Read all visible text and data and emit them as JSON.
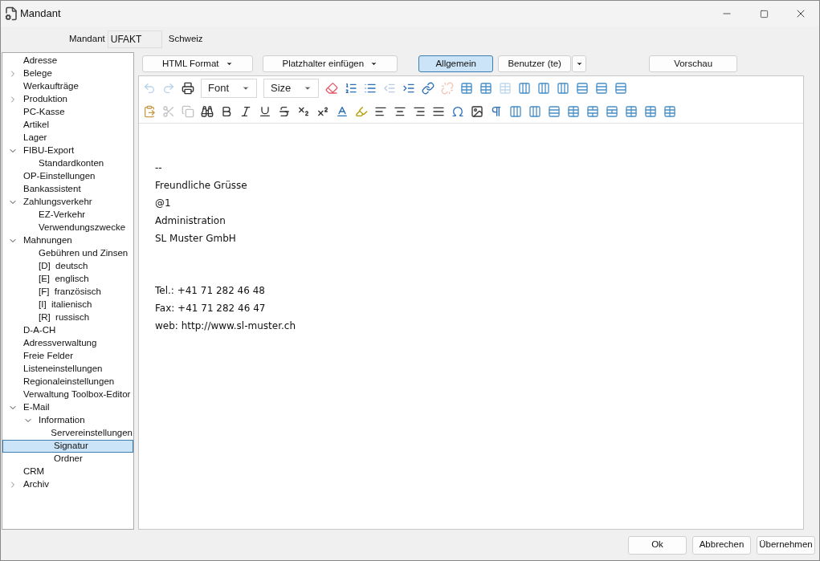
{
  "window": {
    "title": "Mandant"
  },
  "mandant": {
    "label": "Mandant",
    "value": "UFAKT",
    "country": "Schweiz"
  },
  "tree": [
    {
      "label": "Adresse",
      "selected": false
    },
    {
      "label": "Belege",
      "selected": false,
      "expanded": false
    },
    {
      "label": "Werkaufträge",
      "selected": false
    },
    {
      "label": "Produktion",
      "selected": false,
      "expanded": false
    },
    {
      "label": "PC-Kasse",
      "selected": false
    },
    {
      "label": "Artikel",
      "selected": false
    },
    {
      "label": "Lager",
      "selected": false
    },
    {
      "label": "FIBU-Export",
      "selected": false,
      "expanded": true,
      "children": [
        {
          "label": "Standardkonten",
          "selected": false
        }
      ]
    },
    {
      "label": "OP-Einstellungen",
      "selected": false
    },
    {
      "label": "Bankassistent",
      "selected": false
    },
    {
      "label": "Zahlungsverkehr",
      "selected": false,
      "expanded": true,
      "children": [
        {
          "label": "EZ-Verkehr",
          "selected": false
        },
        {
          "label": "Verwendungszwecke",
          "selected": false
        }
      ]
    },
    {
      "label": "Mahnungen",
      "selected": false,
      "expanded": true,
      "children": [
        {
          "label": "Gebühren und Zinsen",
          "selected": false
        },
        {
          "label": "[D]  deutsch",
          "selected": false
        },
        {
          "label": "[E]  englisch",
          "selected": false
        },
        {
          "label": "[F]  französisch",
          "selected": false
        },
        {
          "label": "[I]  italienisch",
          "selected": false
        },
        {
          "label": "[R]  russisch",
          "selected": false
        }
      ]
    },
    {
      "label": "D-A-CH",
      "selected": false
    },
    {
      "label": "Adressverwaltung",
      "selected": false
    },
    {
      "label": "Freie Felder",
      "selected": false
    },
    {
      "label": "Listeneinstellungen",
      "selected": false
    },
    {
      "label": "Regionaleinstellungen",
      "selected": false
    },
    {
      "label": "Verwaltung Toolbox-Editor",
      "selected": false
    },
    {
      "label": "E-Mail",
      "selected": false,
      "expanded": true,
      "children": [
        {
          "label": "Information",
          "selected": false,
          "expanded": true,
          "children": [
            {
              "label": "Servereinstellungen",
              "selected": false
            },
            {
              "label": "Signatur",
              "selected": true
            },
            {
              "label": "Ordner",
              "selected": false
            }
          ]
        }
      ]
    },
    {
      "label": "CRM",
      "selected": false
    },
    {
      "label": "Archiv",
      "selected": false,
      "expanded": false
    }
  ],
  "editor_buttons": [
    {
      "label": "HTML Format",
      "kind": "menu"
    },
    {
      "label": "Platzhalter einfügen",
      "kind": "menu"
    },
    {
      "label": "Allgemein",
      "kind": "toggle",
      "selected": true
    },
    {
      "label": "Benutzer (te)",
      "kind": "split",
      "selected": false
    },
    {
      "label": "Vorschau",
      "kind": "button"
    }
  ],
  "toolbar_rows": [
    [
      {
        "kind": "undo",
        "disabled": true
      },
      {
        "kind": "redo",
        "disabled": true
      },
      {
        "kind": "print",
        "disabled": false
      },
      {
        "kind": "select",
        "value": "Font"
      },
      {
        "kind": "select",
        "value": "Size"
      },
      {
        "kind": "eraser",
        "disabled": false
      },
      {
        "kind": "ordered-list",
        "disabled": false
      },
      {
        "kind": "bullet-list",
        "disabled": false
      },
      {
        "kind": "outdent",
        "disabled": true
      },
      {
        "kind": "indent",
        "disabled": false
      },
      {
        "kind": "link",
        "disabled": false
      },
      {
        "kind": "unlink",
        "disabled": true
      },
      {
        "kind": "table",
        "disabled": false
      },
      {
        "kind": "table",
        "disabled": false
      },
      {
        "kind": "table",
        "disabled": true
      },
      {
        "kind": "column",
        "disabled": false
      },
      {
        "kind": "column",
        "disabled": false
      },
      {
        "kind": "column",
        "disabled": false
      },
      {
        "kind": "row",
        "disabled": false
      },
      {
        "kind": "row",
        "disabled": false
      },
      {
        "kind": "row",
        "disabled": false
      }
    ],
    [
      {
        "kind": "paste",
        "disabled": false
      },
      {
        "kind": "cut",
        "disabled": true
      },
      {
        "kind": "copy",
        "disabled": true
      },
      {
        "kind": "find",
        "disabled": false
      },
      {
        "kind": "bold",
        "disabled": false
      },
      {
        "kind": "italic",
        "disabled": false
      },
      {
        "kind": "underline",
        "disabled": false
      },
      {
        "kind": "strike",
        "disabled": false
      },
      {
        "kind": "subscript",
        "disabled": false
      },
      {
        "kind": "superscript",
        "disabled": false
      },
      {
        "kind": "font-color",
        "disabled": false
      },
      {
        "kind": "highlight",
        "disabled": false
      },
      {
        "kind": "align-left",
        "disabled": false
      },
      {
        "kind": "align-center",
        "disabled": false
      },
      {
        "kind": "align-right",
        "disabled": false
      },
      {
        "kind": "justify",
        "disabled": false
      },
      {
        "kind": "symbol",
        "disabled": false
      },
      {
        "kind": "image",
        "disabled": false
      },
      {
        "kind": "paragraph",
        "disabled": false
      },
      {
        "kind": "column",
        "disabled": false
      },
      {
        "kind": "column",
        "disabled": false
      },
      {
        "kind": "row",
        "disabled": false
      },
      {
        "kind": "table",
        "disabled": false
      },
      {
        "kind": "merge",
        "disabled": false
      },
      {
        "kind": "split",
        "disabled": false
      },
      {
        "kind": "table",
        "disabled": false
      },
      {
        "kind": "table",
        "disabled": false
      },
      {
        "kind": "table",
        "disabled": false
      }
    ]
  ],
  "signature": [
    [
      "--",
      "Freundliche Grüsse",
      "@1",
      "Administration",
      "SL Muster GmbH"
    ],
    [
      "Tel.: +41 71 282 46 48",
      "Fax: +41 71 282 46 47",
      "web: http://www.sl-muster.ch"
    ]
  ],
  "footer_buttons": [
    "Ok",
    "Abbrechen",
    "Übernehmen"
  ]
}
